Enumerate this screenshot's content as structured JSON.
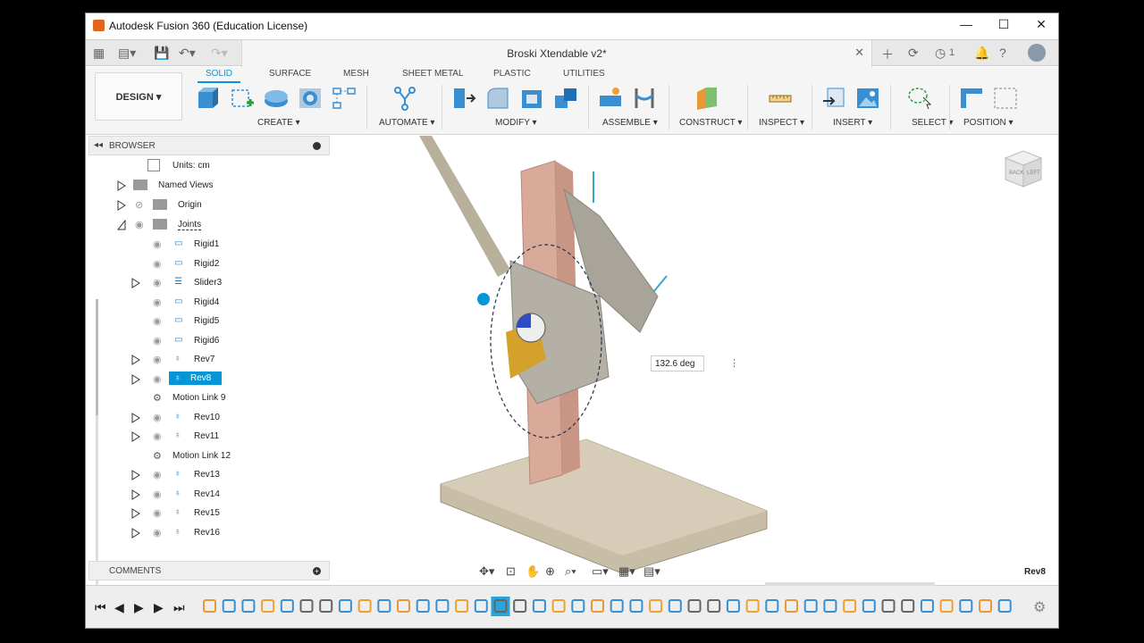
{
  "window": {
    "title": "Autodesk Fusion 360 (Education License)",
    "minimize": "—",
    "maximize": "☐",
    "close": "✕"
  },
  "docbar": {
    "doc_title": "Broski Xtendable v2*",
    "close": "✕",
    "job_count": "1"
  },
  "ribbon": {
    "workspace": "DESIGN ▾",
    "tabs": [
      "SOLID",
      "SURFACE",
      "MESH",
      "SHEET METAL",
      "PLASTIC",
      "UTILITIES"
    ],
    "groups": [
      "CREATE ▾",
      "AUTOMATE ▾",
      "MODIFY ▾",
      "ASSEMBLE ▾",
      "CONSTRUCT ▾",
      "INSPECT ▾",
      "INSERT ▾",
      "SELECT ▾",
      "POSITION ▾"
    ]
  },
  "browser": {
    "title": "BROWSER",
    "items": [
      {
        "label": "Units: cm"
      },
      {
        "label": "Named Views"
      },
      {
        "label": "Origin"
      },
      {
        "label": "Joints"
      },
      {
        "label": "Rigid1"
      },
      {
        "label": "Rigid2"
      },
      {
        "label": "Slider3"
      },
      {
        "label": "Rigid4"
      },
      {
        "label": "Rigid5"
      },
      {
        "label": "Rigid6"
      },
      {
        "label": "Rev7"
      },
      {
        "label": "Rev8"
      },
      {
        "label": "Motion Link 9"
      },
      {
        "label": "Rev10"
      },
      {
        "label": "Rev11"
      },
      {
        "label": "Motion Link 12"
      },
      {
        "label": "Rev13"
      },
      {
        "label": "Rev14"
      },
      {
        "label": "Rev15"
      },
      {
        "label": "Rev16"
      }
    ]
  },
  "comments": {
    "title": "COMMENTS"
  },
  "viewport": {
    "angle_value": "132.6 deg",
    "selection_label": "Rev8",
    "viewcube_faces": [
      "BACK",
      "LEFT"
    ]
  },
  "colors": {
    "accent": "#0696d7",
    "part_pink": "#d9a99a",
    "part_base": "#cfc6b4",
    "part_gold": "#d4a12a"
  }
}
